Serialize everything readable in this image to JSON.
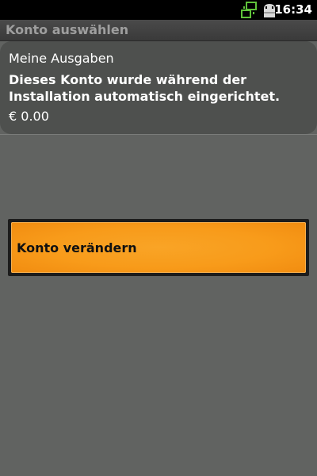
{
  "status_bar": {
    "time": "16:34",
    "icons": [
      "network-sync-icon",
      "usb-debug-icon"
    ]
  },
  "title_bar": {
    "title": "Konto auswählen"
  },
  "account": {
    "name": "Meine Ausgaben",
    "description": "Dieses Konto wurde während der Installation automatisch eingerichtet.",
    "balance": "€ 0.00"
  },
  "context_menu": {
    "items": [
      {
        "label": "Konto verändern"
      }
    ]
  },
  "colors": {
    "background": "#616361",
    "account_item": "#4e504e",
    "menu_highlight": "#f89b1a",
    "title_text": "#9e9e9e",
    "status_icon_green": "#5fc23a"
  }
}
